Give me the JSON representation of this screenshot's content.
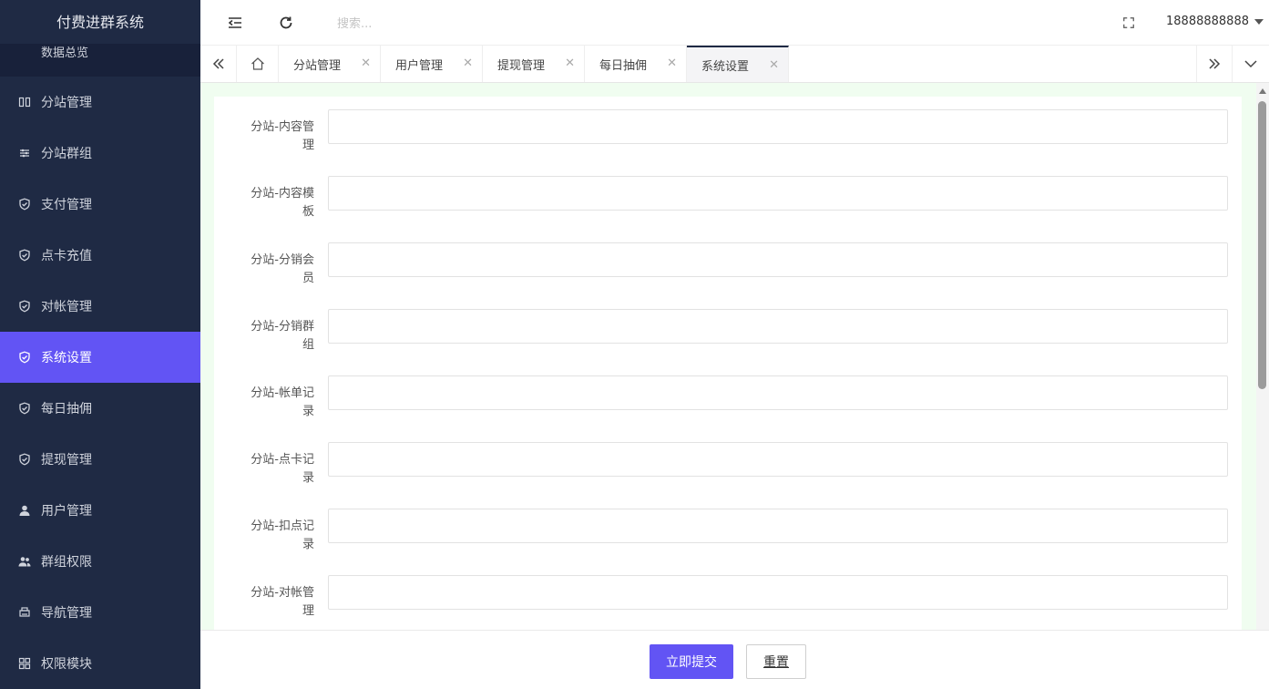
{
  "app": {
    "title": "付费进群系统"
  },
  "sidebar": {
    "sub_item": "数据总览",
    "items": [
      {
        "label": "分站管理",
        "icon": "columns-icon",
        "active": false
      },
      {
        "label": "分站群组",
        "icon": "sliders-icon",
        "active": false
      },
      {
        "label": "支付管理",
        "icon": "shield-check-icon",
        "active": false
      },
      {
        "label": "点卡充值",
        "icon": "shield-check-icon",
        "active": false
      },
      {
        "label": "对帐管理",
        "icon": "shield-check-icon",
        "active": false
      },
      {
        "label": "系统设置",
        "icon": "shield-check-icon",
        "active": true
      },
      {
        "label": "每日抽佣",
        "icon": "shield-check-icon",
        "active": false
      },
      {
        "label": "提现管理",
        "icon": "shield-check-icon",
        "active": false
      },
      {
        "label": "用户管理",
        "icon": "user-icon",
        "active": false
      },
      {
        "label": "群组权限",
        "icon": "users-icon",
        "active": false
      },
      {
        "label": "导航管理",
        "icon": "print-icon",
        "active": false
      },
      {
        "label": "权限模块",
        "icon": "grid-icon",
        "active": false
      }
    ]
  },
  "header": {
    "search_placeholder": "搜索...",
    "user": "18888888888"
  },
  "tabs": [
    {
      "label": "分站管理",
      "active": false
    },
    {
      "label": "用户管理",
      "active": false
    },
    {
      "label": "提现管理",
      "active": false
    },
    {
      "label": "每日抽佣",
      "active": false
    },
    {
      "label": "系统设置",
      "active": true
    }
  ],
  "form": {
    "fields": [
      {
        "label": "分站-内容管理",
        "value": ""
      },
      {
        "label": "分站-内容模板",
        "value": ""
      },
      {
        "label": "分站-分销会员",
        "value": ""
      },
      {
        "label": "分站-分销群组",
        "value": ""
      },
      {
        "label": "分站-帐单记录",
        "value": ""
      },
      {
        "label": "分站-点卡记录",
        "value": ""
      },
      {
        "label": "分站-扣点记录",
        "value": ""
      },
      {
        "label": "分站-对帐管理",
        "value": ""
      }
    ],
    "submit_label": "立即提交",
    "reset_label": "重置"
  }
}
